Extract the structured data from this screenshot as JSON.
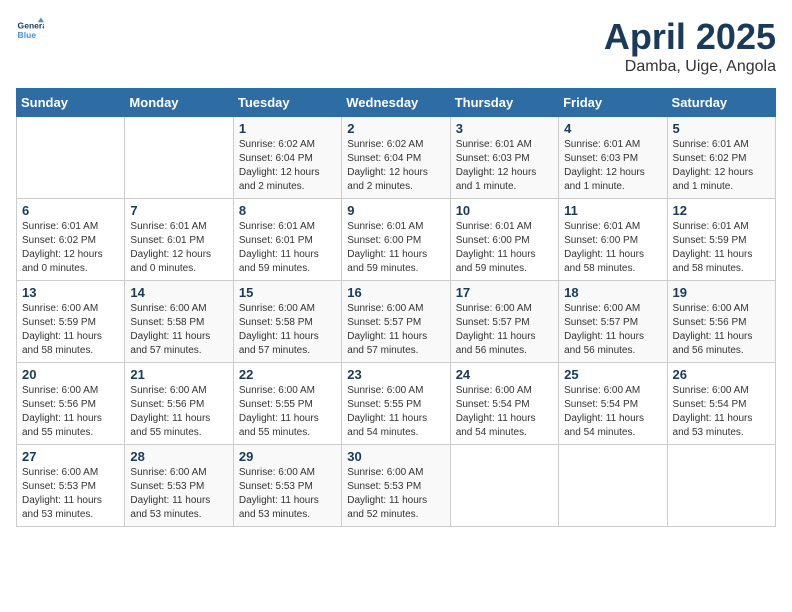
{
  "logo": {
    "line1": "General",
    "line2": "Blue"
  },
  "title": "April 2025",
  "subtitle": "Damba, Uige, Angola",
  "weekdays": [
    "Sunday",
    "Monday",
    "Tuesday",
    "Wednesday",
    "Thursday",
    "Friday",
    "Saturday"
  ],
  "weeks": [
    [
      {
        "day": "",
        "detail": ""
      },
      {
        "day": "",
        "detail": ""
      },
      {
        "day": "1",
        "detail": "Sunrise: 6:02 AM\nSunset: 6:04 PM\nDaylight: 12 hours and 2 minutes."
      },
      {
        "day": "2",
        "detail": "Sunrise: 6:02 AM\nSunset: 6:04 PM\nDaylight: 12 hours and 2 minutes."
      },
      {
        "day": "3",
        "detail": "Sunrise: 6:01 AM\nSunset: 6:03 PM\nDaylight: 12 hours and 1 minute."
      },
      {
        "day": "4",
        "detail": "Sunrise: 6:01 AM\nSunset: 6:03 PM\nDaylight: 12 hours and 1 minute."
      },
      {
        "day": "5",
        "detail": "Sunrise: 6:01 AM\nSunset: 6:02 PM\nDaylight: 12 hours and 1 minute."
      }
    ],
    [
      {
        "day": "6",
        "detail": "Sunrise: 6:01 AM\nSunset: 6:02 PM\nDaylight: 12 hours and 0 minutes."
      },
      {
        "day": "7",
        "detail": "Sunrise: 6:01 AM\nSunset: 6:01 PM\nDaylight: 12 hours and 0 minutes."
      },
      {
        "day": "8",
        "detail": "Sunrise: 6:01 AM\nSunset: 6:01 PM\nDaylight: 11 hours and 59 minutes."
      },
      {
        "day": "9",
        "detail": "Sunrise: 6:01 AM\nSunset: 6:00 PM\nDaylight: 11 hours and 59 minutes."
      },
      {
        "day": "10",
        "detail": "Sunrise: 6:01 AM\nSunset: 6:00 PM\nDaylight: 11 hours and 59 minutes."
      },
      {
        "day": "11",
        "detail": "Sunrise: 6:01 AM\nSunset: 6:00 PM\nDaylight: 11 hours and 58 minutes."
      },
      {
        "day": "12",
        "detail": "Sunrise: 6:01 AM\nSunset: 5:59 PM\nDaylight: 11 hours and 58 minutes."
      }
    ],
    [
      {
        "day": "13",
        "detail": "Sunrise: 6:00 AM\nSunset: 5:59 PM\nDaylight: 11 hours and 58 minutes."
      },
      {
        "day": "14",
        "detail": "Sunrise: 6:00 AM\nSunset: 5:58 PM\nDaylight: 11 hours and 57 minutes."
      },
      {
        "day": "15",
        "detail": "Sunrise: 6:00 AM\nSunset: 5:58 PM\nDaylight: 11 hours and 57 minutes."
      },
      {
        "day": "16",
        "detail": "Sunrise: 6:00 AM\nSunset: 5:57 PM\nDaylight: 11 hours and 57 minutes."
      },
      {
        "day": "17",
        "detail": "Sunrise: 6:00 AM\nSunset: 5:57 PM\nDaylight: 11 hours and 56 minutes."
      },
      {
        "day": "18",
        "detail": "Sunrise: 6:00 AM\nSunset: 5:57 PM\nDaylight: 11 hours and 56 minutes."
      },
      {
        "day": "19",
        "detail": "Sunrise: 6:00 AM\nSunset: 5:56 PM\nDaylight: 11 hours and 56 minutes."
      }
    ],
    [
      {
        "day": "20",
        "detail": "Sunrise: 6:00 AM\nSunset: 5:56 PM\nDaylight: 11 hours and 55 minutes."
      },
      {
        "day": "21",
        "detail": "Sunrise: 6:00 AM\nSunset: 5:56 PM\nDaylight: 11 hours and 55 minutes."
      },
      {
        "day": "22",
        "detail": "Sunrise: 6:00 AM\nSunset: 5:55 PM\nDaylight: 11 hours and 55 minutes."
      },
      {
        "day": "23",
        "detail": "Sunrise: 6:00 AM\nSunset: 5:55 PM\nDaylight: 11 hours and 54 minutes."
      },
      {
        "day": "24",
        "detail": "Sunrise: 6:00 AM\nSunset: 5:54 PM\nDaylight: 11 hours and 54 minutes."
      },
      {
        "day": "25",
        "detail": "Sunrise: 6:00 AM\nSunset: 5:54 PM\nDaylight: 11 hours and 54 minutes."
      },
      {
        "day": "26",
        "detail": "Sunrise: 6:00 AM\nSunset: 5:54 PM\nDaylight: 11 hours and 53 minutes."
      }
    ],
    [
      {
        "day": "27",
        "detail": "Sunrise: 6:00 AM\nSunset: 5:53 PM\nDaylight: 11 hours and 53 minutes."
      },
      {
        "day": "28",
        "detail": "Sunrise: 6:00 AM\nSunset: 5:53 PM\nDaylight: 11 hours and 53 minutes."
      },
      {
        "day": "29",
        "detail": "Sunrise: 6:00 AM\nSunset: 5:53 PM\nDaylight: 11 hours and 53 minutes."
      },
      {
        "day": "30",
        "detail": "Sunrise: 6:00 AM\nSunset: 5:53 PM\nDaylight: 11 hours and 52 minutes."
      },
      {
        "day": "",
        "detail": ""
      },
      {
        "day": "",
        "detail": ""
      },
      {
        "day": "",
        "detail": ""
      }
    ]
  ]
}
